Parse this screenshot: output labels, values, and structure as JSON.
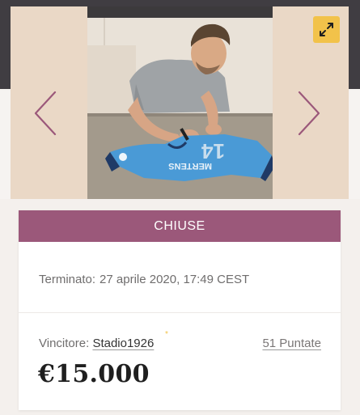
{
  "gallery": {
    "photo_alt": "",
    "prev_icon": "chevron-left-icon",
    "next_icon": "chevron-right-icon",
    "expand_icon": "expand-arrows-icon",
    "accent_color": "#f2c24a",
    "arrow_color": "#9b587a"
  },
  "jersey": {
    "print_name": "MERTENS"
  },
  "auction": {
    "status_label": "CHIUSE",
    "status_color": "#9b587a",
    "ended_label": "Terminato:",
    "ended_date": "27 aprile 2020, 17:49 CEST",
    "winner_label": "Vincitore:",
    "winner_name": "Stadio1926",
    "winner_star": "*",
    "bids_link": "51 Puntate",
    "final_price": "€15.000"
  }
}
